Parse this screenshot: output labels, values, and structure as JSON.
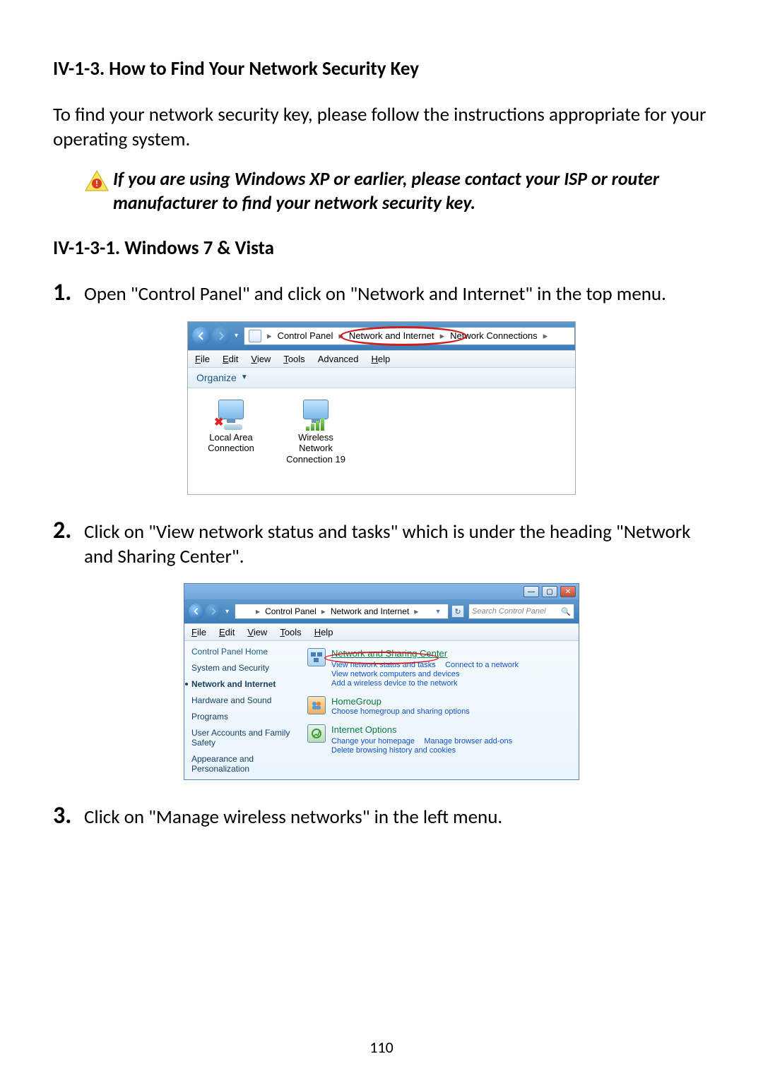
{
  "heading": "IV-1-3. How to Find Your Network Security Key",
  "intro": "To find your network security key, please follow the instructions appropriate for your operating system.",
  "note": "If you are using Windows XP or earlier, please contact your ISP or router manufacturer to find your network security key.",
  "subsection": "IV-1-3-1.    Windows 7 & Vista",
  "steps": {
    "s1": {
      "num": "1.",
      "text": "Open \"Control Panel\" and click on \"Network and Internet\" in the top menu."
    },
    "s2": {
      "num": "2.",
      "text": "Click on \"View network status and tasks\" which is under the heading \"Network and Sharing Center\"."
    },
    "s3": {
      "num": "3.",
      "text": "Click on \"Manage wireless networks\" in the left menu."
    }
  },
  "shot1": {
    "breadcrumb": {
      "p1": "Control Panel",
      "p2": "Network and Internet",
      "p3": "Network Connections"
    },
    "menu": {
      "file": "File",
      "edit": "Edit",
      "view": "View",
      "tools": "Tools",
      "advanced": "Advanced",
      "help": "Help"
    },
    "toolbar": {
      "organize": "Organize"
    },
    "items": {
      "lan": "Local Area Connection",
      "wlan": "Wireless Network Connection 19"
    }
  },
  "shot2": {
    "breadcrumb": {
      "p1": "Control Panel",
      "p2": "Network and Internet"
    },
    "search_placeholder": "Search Control Panel",
    "menu": {
      "file": "File",
      "edit": "Edit",
      "view": "View",
      "tools": "Tools",
      "help": "Help"
    },
    "side": {
      "home": "Control Panel Home",
      "i1": "System and Security",
      "i2": "Network and Internet",
      "i3": "Hardware and Sound",
      "i4": "Programs",
      "i5": "User Accounts and Family Safety",
      "i6": "Appearance and Personalization"
    },
    "main": {
      "sec1": {
        "title": "Network and Sharing Center",
        "l1": "View network status and tasks",
        "l2": "Connect to a network",
        "l3": "View network computers and devices",
        "l4": "Add a wireless device to the network"
      },
      "sec2": {
        "title": "HomeGroup",
        "l1": "Choose homegroup and sharing options"
      },
      "sec3": {
        "title": "Internet Options",
        "l1": "Change your homepage",
        "l2": "Manage browser add-ons",
        "l3": "Delete browsing history and cookies"
      }
    }
  },
  "pagenum": "110"
}
